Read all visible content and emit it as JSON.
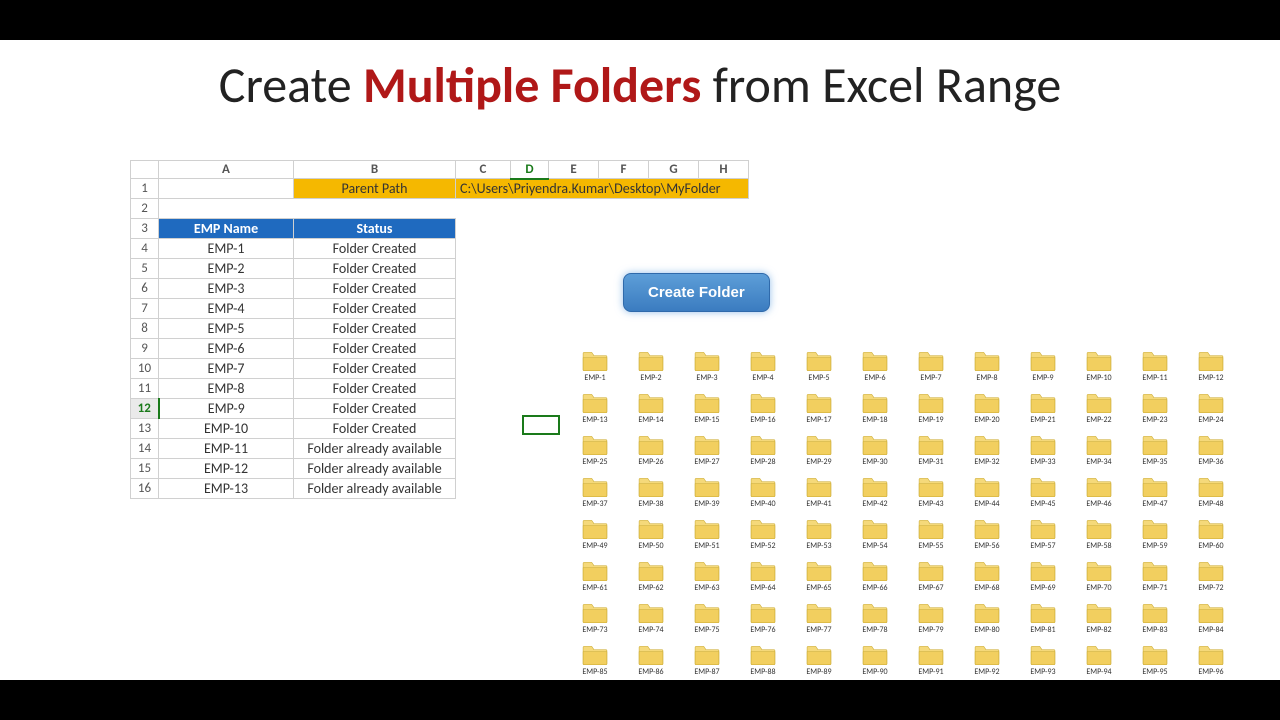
{
  "title": {
    "pre": "Create ",
    "accent": "Multiple Folders",
    "post": " from Excel Range"
  },
  "column_headers": [
    "A",
    "B",
    "C",
    "D",
    "E",
    "F",
    "G",
    "H"
  ],
  "parent_path_label": "Parent Path",
  "parent_path_value": "C:\\Users\\Priyendra.Kumar\\Desktop\\MyFolder",
  "data_headers": {
    "emp": "EMP Name",
    "status": "Status"
  },
  "rows": [
    {
      "n": "4",
      "emp": "EMP-1",
      "status": "Folder Created"
    },
    {
      "n": "5",
      "emp": "EMP-2",
      "status": "Folder Created"
    },
    {
      "n": "6",
      "emp": "EMP-3",
      "status": "Folder Created"
    },
    {
      "n": "7",
      "emp": "EMP-4",
      "status": "Folder Created"
    },
    {
      "n": "8",
      "emp": "EMP-5",
      "status": "Folder Created"
    },
    {
      "n": "9",
      "emp": "EMP-6",
      "status": "Folder Created"
    },
    {
      "n": "10",
      "emp": "EMP-7",
      "status": "Folder Created"
    },
    {
      "n": "11",
      "emp": "EMP-8",
      "status": "Folder Created"
    },
    {
      "n": "12",
      "emp": "EMP-9",
      "status": "Folder Created"
    },
    {
      "n": "13",
      "emp": "EMP-10",
      "status": "Folder Created"
    },
    {
      "n": "14",
      "emp": "EMP-11",
      "status": "Folder already available"
    },
    {
      "n": "15",
      "emp": "EMP-12",
      "status": "Folder already available"
    },
    {
      "n": "16",
      "emp": "EMP-13",
      "status": "Folder already available"
    }
  ],
  "row_headers_top": [
    "1",
    "2",
    "3"
  ],
  "button_label": "Create Folder",
  "folder_prefix": "EMP-",
  "folder_count": 96,
  "folders_per_row": 12,
  "selected_row": "12",
  "selected_col": "D"
}
